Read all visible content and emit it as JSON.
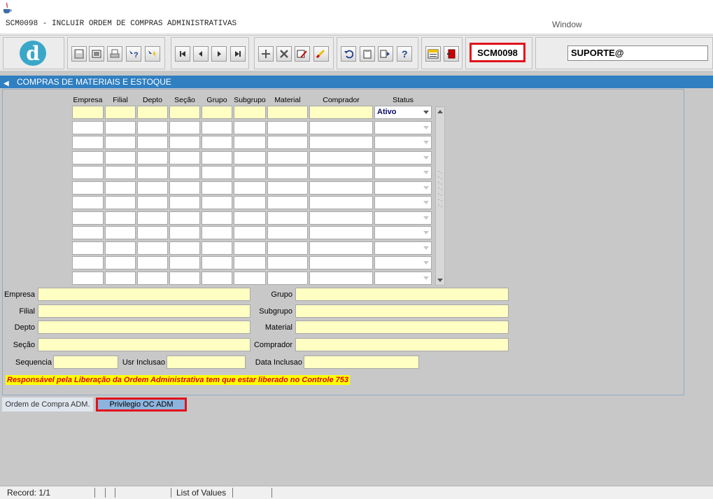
{
  "window": {
    "title": "SCM0098 - INCLUIR ORDEM DE COMPRAS ADMINISTRATIVAS",
    "menu_window": "Window"
  },
  "toolbar": {
    "icons": [
      "save-icon",
      "window-icon",
      "print-icon",
      "query-help-icon",
      "query-execute-icon",
      "first-record-icon",
      "previous-record-icon",
      "next-record-icon",
      "last-record-icon",
      "insert-record-icon",
      "delete-record-icon",
      "edit-record-icon",
      "clear-record-icon",
      "undo-icon",
      "clipboard-icon",
      "list-values-icon",
      "help-icon",
      "menu-icon",
      "exit-icon"
    ],
    "form_code": "SCM0098",
    "user": "SUPORTE@"
  },
  "panel": {
    "title": "COMPRAS DE MATERIAIS E ESTOQUE",
    "columns": [
      "Empresa",
      "Filial",
      "Depto",
      "Seção",
      "Grupo",
      "Subgrupo",
      "Material",
      "Comprador",
      "Status"
    ],
    "first_row_status": "Ativo",
    "row_count": 12
  },
  "detail": {
    "empresa_label": "Empresa",
    "filial_label": "Filial",
    "depto_label": "Depto",
    "secao_label": "Seção",
    "grupo_label": "Grupo",
    "subgrupo_label": "Subgrupo",
    "material_label": "Material",
    "comprador_label": "Comprador",
    "sequencia_label": "Sequencia",
    "usr_inclusao_label": "Usr Inclusao",
    "data_inclusao_label": "Data Inclusao",
    "warning": "Responsável pela Liberação da Ordem Administrativa tem que estar liberado no Controle 753"
  },
  "tabs": {
    "tab1": "Ordem de Compra ADM.",
    "tab2": "Privilegio OC ADM"
  },
  "statusbar": {
    "record": "Record: 1/1",
    "list_values": "List of Values"
  },
  "colors": {
    "highlight_red": "#e3121b",
    "panel_blue": "#2f7fc1",
    "field_yellow": "#ffffc4",
    "warning_yellow": "#ffff00"
  }
}
